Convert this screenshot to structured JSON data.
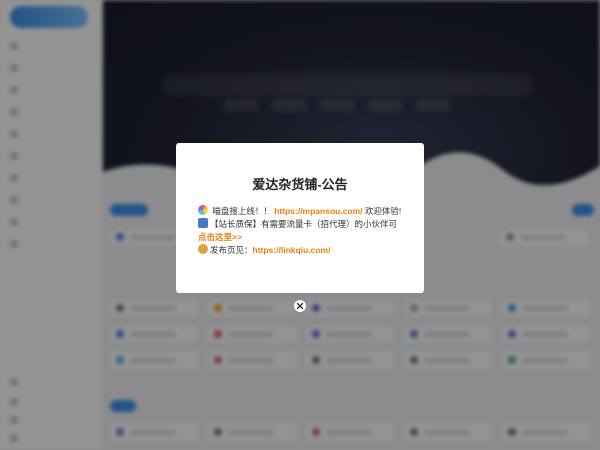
{
  "modal": {
    "title": "爱达杂货铺-公告",
    "line1": {
      "icon": "rainbow-icon",
      "prefix": " 喵盘搜上线！！ ",
      "link": "https://mpansou.com/",
      "suffix": " 欢迎体验!"
    },
    "line2": {
      "icon": "medal-icon",
      "prefix": "【站长质保】有需要流量卡（招代理）的小伙伴可",
      "link": "点击这里>>"
    },
    "line3": {
      "icon": "cookie-icon",
      "prefix": "发布页见：",
      "link": "https://linkqiu.com/"
    },
    "close_icon": "close-icon"
  },
  "colors": {
    "link": "#e8820c",
    "overlay": "rgba(0,0,0,0.42)",
    "accent": "#3d8ff0",
    "hero_bg": "#1f2236"
  }
}
